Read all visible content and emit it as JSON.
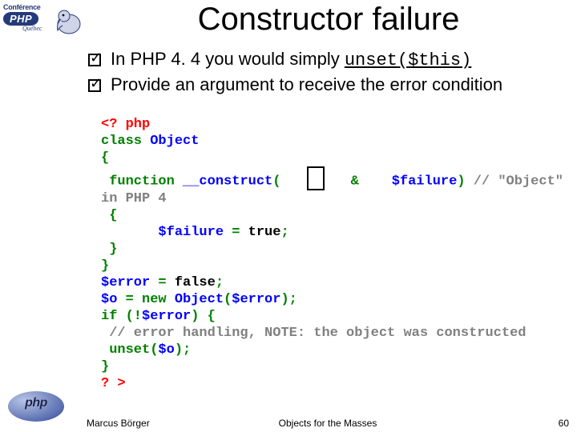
{
  "logo": {
    "conference": "Conférence",
    "php": "PHP",
    "quebec": "Québec"
  },
  "title": "Constructor failure",
  "bullets": [
    {
      "prefix": "In PHP 4. 4 you would simply ",
      "code_parts": [
        "unset",
        "(",
        "$this",
        ")"
      ]
    },
    {
      "text": "Provide an argument to receive the error condition"
    }
  ],
  "code": {
    "l1": "<? php",
    "l2a": "class",
    "l2b": " Object",
    "l3": "{",
    "l4a": " function ",
    "l4b": "__construct",
    "l4c": "(",
    "l4amp": "&",
    "l4d": "$failure",
    "l4e": ") ",
    "l4f": "// \"Object\"",
    "l5": "in PHP 4",
    "l6": " {",
    "l7a": "       $failure ",
    "l7b": "= ",
    "l7c": "true",
    "l7d": ";",
    "l8": " }",
    "l9": "}",
    "l10a": "$error ",
    "l10b": "= ",
    "l10c": "false",
    "l10d": ";",
    "l11a": "$o ",
    "l11b": "= new ",
    "l11c": "Object",
    "l11d": "(",
    "l11e": "$error",
    "l11f": ");",
    "l12a": "if ",
    "l12b": "(!",
    "l12c": "$error",
    "l12d": ") {",
    "l13": " // error handling, NOTE: the object was constructed",
    "l14a": " unset",
    "l14b": "(",
    "l14c": "$o",
    "l14d": ");",
    "l15": "}",
    "l16": "? >"
  },
  "footer": {
    "author": "Marcus Börger",
    "title": "Objects for the Masses",
    "page": "60"
  },
  "logo_bottom": "php"
}
